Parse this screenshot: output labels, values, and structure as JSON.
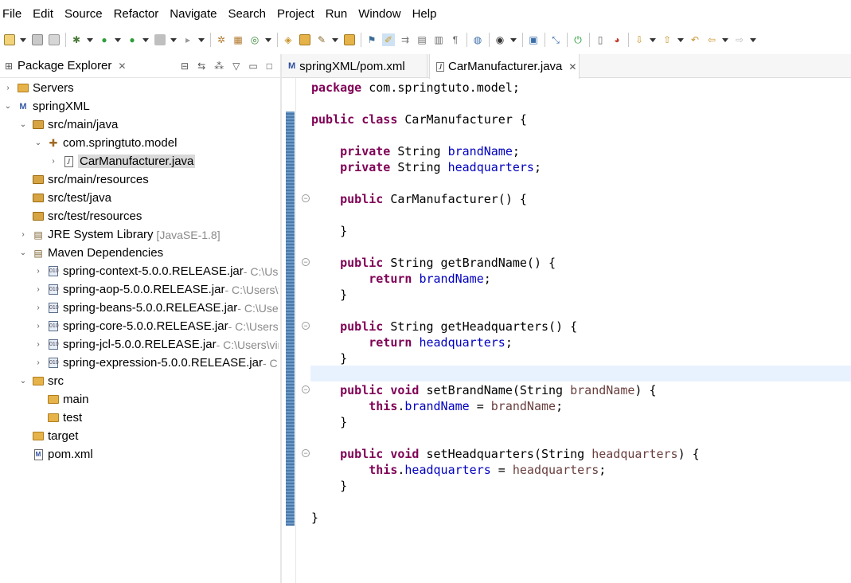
{
  "menu": [
    "File",
    "Edit",
    "Source",
    "Refactor",
    "Navigate",
    "Search",
    "Project",
    "Run",
    "Window",
    "Help"
  ],
  "package_explorer": {
    "title": "Package Explorer",
    "close_glyph": "✕"
  },
  "tree": [
    {
      "label": "Servers",
      "decoration": "",
      "depth": 0,
      "twisty": "›",
      "icon": "folder"
    },
    {
      "label": "springXML",
      "decoration": "",
      "depth": 0,
      "twisty": "⌄",
      "icon": "project"
    },
    {
      "label": "src/main/java",
      "decoration": "",
      "depth": 1,
      "twisty": "⌄",
      "icon": "source-folder"
    },
    {
      "label": "com.springtuto.model",
      "decoration": "",
      "depth": 2,
      "twisty": "⌄",
      "icon": "package"
    },
    {
      "label": "CarManufacturer.java",
      "decoration": "",
      "depth": 3,
      "twisty": "›",
      "icon": "java-file"
    },
    {
      "label": "src/main/resources",
      "decoration": "",
      "depth": 1,
      "twisty": "",
      "icon": "source-folder"
    },
    {
      "label": "src/test/java",
      "decoration": "",
      "depth": 1,
      "twisty": "",
      "icon": "source-folder"
    },
    {
      "label": "src/test/resources",
      "decoration": "",
      "depth": 1,
      "twisty": "",
      "icon": "source-folder"
    },
    {
      "label": "JRE System Library",
      "decoration": "[JavaSE-1.8]",
      "depth": 1,
      "twisty": "›",
      "icon": "library"
    },
    {
      "label": "Maven Dependencies",
      "decoration": "",
      "depth": 1,
      "twisty": "⌄",
      "icon": "library"
    },
    {
      "label": "spring-context-5.0.0.RELEASE.jar",
      "decoration": " - C:\\Use",
      "depth": 2,
      "twisty": "›",
      "icon": "jar"
    },
    {
      "label": "spring-aop-5.0.0.RELEASE.jar",
      "decoration": " - C:\\Users\\v",
      "depth": 2,
      "twisty": "›",
      "icon": "jar"
    },
    {
      "label": "spring-beans-5.0.0.RELEASE.jar",
      "decoration": " - C:\\Users",
      "depth": 2,
      "twisty": "›",
      "icon": "jar"
    },
    {
      "label": "spring-core-5.0.0.RELEASE.jar",
      "decoration": " - C:\\Users\\",
      "depth": 2,
      "twisty": "›",
      "icon": "jar"
    },
    {
      "label": "spring-jcl-5.0.0.RELEASE.jar",
      "decoration": " - C:\\Users\\vir",
      "depth": 2,
      "twisty": "›",
      "icon": "jar"
    },
    {
      "label": "spring-expression-5.0.0.RELEASE.jar",
      "decoration": " - C:\\",
      "depth": 2,
      "twisty": "›",
      "icon": "jar"
    },
    {
      "label": "src",
      "decoration": "",
      "depth": 1,
      "twisty": "⌄",
      "icon": "folder"
    },
    {
      "label": "main",
      "decoration": "",
      "depth": 2,
      "twisty": "",
      "icon": "folder"
    },
    {
      "label": "test",
      "decoration": "",
      "depth": 2,
      "twisty": "",
      "icon": "folder"
    },
    {
      "label": "target",
      "decoration": "",
      "depth": 1,
      "twisty": "",
      "icon": "folder"
    },
    {
      "label": "pom.xml",
      "decoration": "",
      "depth": 1,
      "twisty": "",
      "icon": "pom"
    }
  ],
  "selected_row": "CarManufacturer.java",
  "editor_tabs": [
    {
      "label": "springXML/pom.xml",
      "icon": "maven-icon",
      "active": false
    },
    {
      "label": "CarManufacturer.java",
      "icon": "java-file-icon",
      "active": true
    }
  ],
  "code_lines": [
    [
      {
        "t": "package",
        "c": "kw"
      },
      {
        "t": " com.springtuto.model;",
        "c": ""
      }
    ],
    [],
    [
      {
        "t": "public",
        "c": "kw"
      },
      {
        "t": " ",
        "c": ""
      },
      {
        "t": "class",
        "c": "kw"
      },
      {
        "t": " CarManufacturer {",
        "c": ""
      }
    ],
    [],
    [
      {
        "t": "    ",
        "c": ""
      },
      {
        "t": "private",
        "c": "kw"
      },
      {
        "t": " String ",
        "c": ""
      },
      {
        "t": "brandName",
        "c": "fld"
      },
      {
        "t": ";",
        "c": ""
      }
    ],
    [
      {
        "t": "    ",
        "c": ""
      },
      {
        "t": "private",
        "c": "kw"
      },
      {
        "t": " String ",
        "c": ""
      },
      {
        "t": "headquarters",
        "c": "fld"
      },
      {
        "t": ";",
        "c": ""
      }
    ],
    [],
    [
      {
        "t": "    ",
        "c": ""
      },
      {
        "t": "public",
        "c": "kw"
      },
      {
        "t": " CarManufacturer() {",
        "c": ""
      }
    ],
    [],
    [
      {
        "t": "    }",
        "c": ""
      }
    ],
    [],
    [
      {
        "t": "    ",
        "c": ""
      },
      {
        "t": "public",
        "c": "kw"
      },
      {
        "t": " String getBrandName() {",
        "c": ""
      }
    ],
    [
      {
        "t": "        ",
        "c": ""
      },
      {
        "t": "return",
        "c": "kw"
      },
      {
        "t": " ",
        "c": ""
      },
      {
        "t": "brandName",
        "c": "fld"
      },
      {
        "t": ";",
        "c": ""
      }
    ],
    [
      {
        "t": "    }",
        "c": ""
      }
    ],
    [],
    [
      {
        "t": "    ",
        "c": ""
      },
      {
        "t": "public",
        "c": "kw"
      },
      {
        "t": " String getHeadquarters() {",
        "c": ""
      }
    ],
    [
      {
        "t": "        ",
        "c": ""
      },
      {
        "t": "return",
        "c": "kw"
      },
      {
        "t": " ",
        "c": ""
      },
      {
        "t": "headquarters",
        "c": "fld"
      },
      {
        "t": ";",
        "c": ""
      }
    ],
    [
      {
        "t": "    }",
        "c": ""
      }
    ],
    [],
    [
      {
        "t": "    ",
        "c": ""
      },
      {
        "t": "public",
        "c": "kw"
      },
      {
        "t": " ",
        "c": ""
      },
      {
        "t": "void",
        "c": "kw"
      },
      {
        "t": " setBrandName(String ",
        "c": ""
      },
      {
        "t": "brandName",
        "c": "prm"
      },
      {
        "t": ") {",
        "c": ""
      }
    ],
    [
      {
        "t": "        ",
        "c": ""
      },
      {
        "t": "this",
        "c": "kw"
      },
      {
        "t": ".",
        "c": ""
      },
      {
        "t": "brandName",
        "c": "fld"
      },
      {
        "t": " = ",
        "c": ""
      },
      {
        "t": "brandName",
        "c": "prm"
      },
      {
        "t": ";",
        "c": ""
      }
    ],
    [
      {
        "t": "    }",
        "c": ""
      }
    ],
    [],
    [
      {
        "t": "    ",
        "c": ""
      },
      {
        "t": "public",
        "c": "kw"
      },
      {
        "t": " ",
        "c": ""
      },
      {
        "t": "void",
        "c": "kw"
      },
      {
        "t": " setHeadquarters(String ",
        "c": ""
      },
      {
        "t": "headquarters",
        "c": "prm"
      },
      {
        "t": ") {",
        "c": ""
      }
    ],
    [
      {
        "t": "        ",
        "c": ""
      },
      {
        "t": "this",
        "c": "kw"
      },
      {
        "t": ".",
        "c": ""
      },
      {
        "t": "headquarters",
        "c": "fld"
      },
      {
        "t": " = ",
        "c": ""
      },
      {
        "t": "headquarters",
        "c": "prm"
      },
      {
        "t": ";",
        "c": ""
      }
    ],
    [
      {
        "t": "    }",
        "c": ""
      }
    ],
    [],
    [
      {
        "t": "}",
        "c": ""
      }
    ]
  ],
  "fold_markers_on_lines": [
    7,
    11,
    15,
    19,
    23
  ],
  "current_line": 18,
  "colors": {
    "keyword": "#7f0055",
    "field": "#0000c0",
    "parameter": "#6a3e3e",
    "current_line_bg": "#e8f2fe",
    "selection_bg": "#d9d9d9"
  },
  "toolbar_icons": [
    "new-icon",
    "save-icon",
    "save-all-icon",
    "debug-icon",
    "run-icon",
    "run-external-icon",
    "stop-icon",
    "skip-icon",
    "new-java-project-icon",
    "new-package-icon",
    "new-class-icon",
    "open-type-icon",
    "open-folder-icon",
    "search-icon",
    "open-task-icon",
    "annotation-icon",
    "highlight-icon",
    "toggle-icon",
    "mark-occurrences-icon",
    "block-select-icon",
    "show-whitespace-icon",
    "globe-icon",
    "avatar-icon",
    "console-icon",
    "pin-icon",
    "power-icon",
    "open-perspective-icon",
    "java-perspective-icon",
    "next-annotation-icon",
    "prev-annotation-icon",
    "last-edit-icon",
    "back-icon",
    "forward-icon"
  ]
}
